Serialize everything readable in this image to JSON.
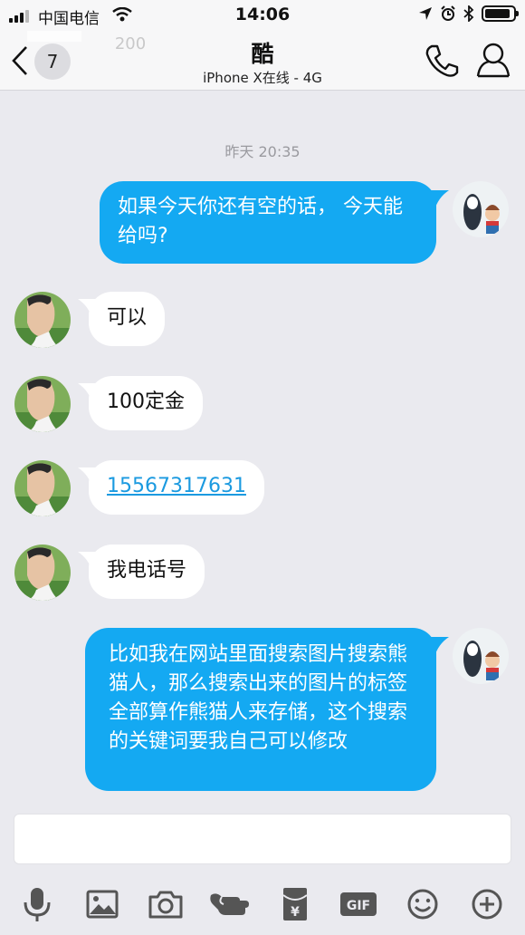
{
  "status_bar": {
    "carrier": "中国电信",
    "time": "14:06"
  },
  "nav": {
    "unread_count": "7",
    "title": "酷",
    "subtitle": "iPhone X在线 - 4G",
    "partial_previous": "200"
  },
  "chat": {
    "timestamp": "昨天 20:35",
    "messages": [
      {
        "side": "out",
        "text": "如果今天你还有空的话， 今天能给吗?"
      },
      {
        "side": "in",
        "text": "可以"
      },
      {
        "side": "in",
        "text": "100定金"
      },
      {
        "side": "in",
        "text": "15567317631",
        "link": true
      },
      {
        "side": "in",
        "text": "我电话号"
      },
      {
        "side": "out",
        "text": "比如我在网站里面搜索图片搜索熊猫人，那么搜索出来的图片的标签全部算作熊猫人来存储，这个搜索的关键词要我自己可以修改"
      }
    ]
  },
  "toolbar": {
    "icons": [
      "microphone-icon",
      "image-icon",
      "camera-icon",
      "poke-icon",
      "red-packet-icon",
      "gif-icon",
      "emoji-icon",
      "plus-icon"
    ],
    "gif_label": "GIF",
    "yuan_label": "¥"
  },
  "colors": {
    "outgoing_bubble": "#14a9f2",
    "background": "#eaeaef",
    "link": "#1b9ae0"
  }
}
